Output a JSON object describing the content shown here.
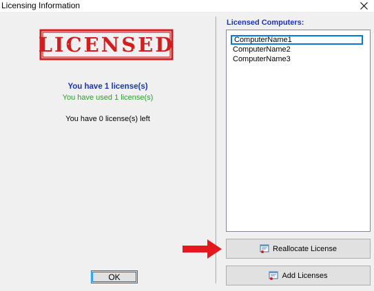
{
  "window": {
    "title": "Licensing Information"
  },
  "stamp": {
    "text": "LICENSED"
  },
  "license_info": {
    "count_text": "You have 1 license(s)",
    "used_text": "You have used 1 license(s)",
    "left_text": "You have 0 license(s) left"
  },
  "computers": {
    "label": "Licensed Computers:",
    "items": [
      "ComputerName1",
      "ComputerName2",
      "ComputerName3"
    ],
    "selected": "ComputerName1"
  },
  "buttons": {
    "ok_label": "OK",
    "reallocate_label": "Reallocate License",
    "add_label": "Add Licenses"
  },
  "colors": {
    "stamp_red": "#d11f1f",
    "heading_blue": "#1a34b8",
    "used_green": "#28a028",
    "arrow_red": "#e4181d",
    "focus_blue": "#0078d7"
  }
}
